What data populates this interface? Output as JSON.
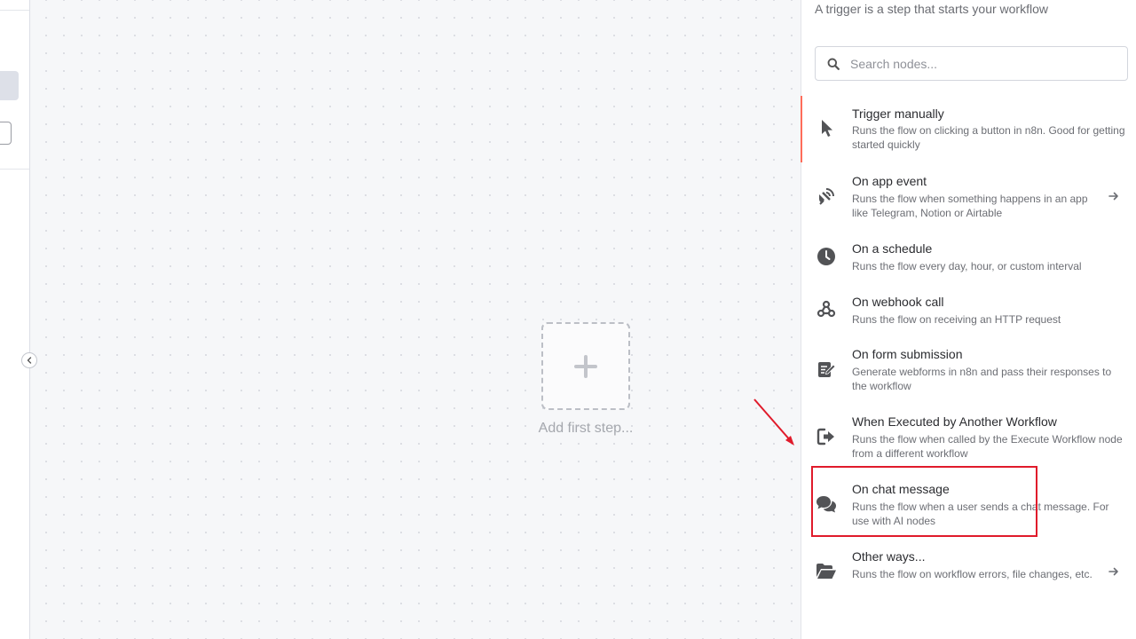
{
  "panel": {
    "subtitle": "A trigger is a step that starts your workflow",
    "search": {
      "placeholder": "Search nodes...",
      "icon": "search-icon"
    }
  },
  "canvas": {
    "add_first_step_label": "Add first step..."
  },
  "triggers": [
    {
      "title": "Trigger manually",
      "description": "Runs the flow on clicking a button in n8n. Good for getting started quickly",
      "icon": "cursor-icon",
      "active": true
    },
    {
      "title": "On app event",
      "description": "Runs the flow when something happens in an app like Telegram, Notion or Airtable",
      "icon": "satellite-icon",
      "has_submenu": true
    },
    {
      "title": "On a schedule",
      "description": "Runs the flow every day, hour, or custom interval",
      "icon": "clock-icon"
    },
    {
      "title": "On webhook call",
      "description": "Runs the flow on receiving an HTTP request",
      "icon": "webhook-icon"
    },
    {
      "title": "On form submission",
      "description": "Generate webforms in n8n and pass their responses to the workflow",
      "icon": "form-icon"
    },
    {
      "title": "When Executed by Another Workflow",
      "description": "Runs the flow when called by the Execute Workflow node from a different workflow",
      "icon": "sign-in-icon"
    },
    {
      "title": "On chat message",
      "description": "Runs the flow when a user sends a chat message. For use with AI nodes",
      "icon": "chat-icon",
      "highlighted": true
    },
    {
      "title": "Other ways...",
      "description": "Runs the flow on workflow errors, file changes, etc.",
      "icon": "folder-open-icon",
      "has_submenu": true
    }
  ],
  "colors": {
    "accent": "#ff6d5a",
    "annotation": "#e01b2b",
    "icon": "#525356"
  }
}
